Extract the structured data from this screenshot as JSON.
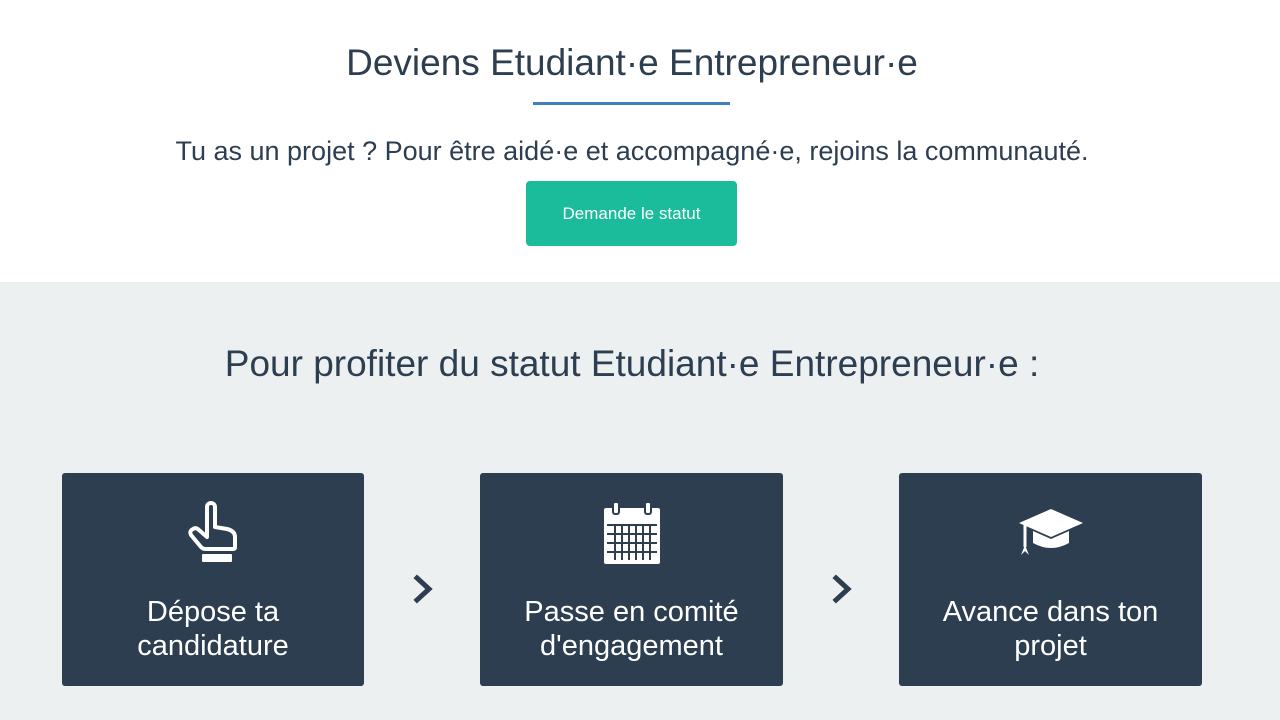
{
  "hero": {
    "title": "Deviens Etudiant·e Entrepreneur·e",
    "subtitle": "Tu as un projet ? Pour être aidé·e et accompagné·e, rejoins la communauté.",
    "cta_label": "Demande le statut"
  },
  "steps_section": {
    "title": "Pour profiter du statut Etudiant·e Entrepreneur·e :",
    "steps": [
      {
        "icon": "pointing-hand-icon",
        "label_line1": "Dépose ta",
        "label_line2": "candidature"
      },
      {
        "icon": "calendar-icon",
        "label_line1": "Passe en comité",
        "label_line2": "d'engagement"
      },
      {
        "icon": "graduation-cap-icon",
        "label_line1": "Avance dans ton",
        "label_line2": "projet"
      }
    ],
    "separator_icon": "chevron-right-icon"
  },
  "colors": {
    "text": "#2c3e50",
    "accent_line": "#3f7fbf",
    "cta": "#1abc9c",
    "section_bg": "#ecf0f1",
    "card_bg": "#2c3e50"
  }
}
